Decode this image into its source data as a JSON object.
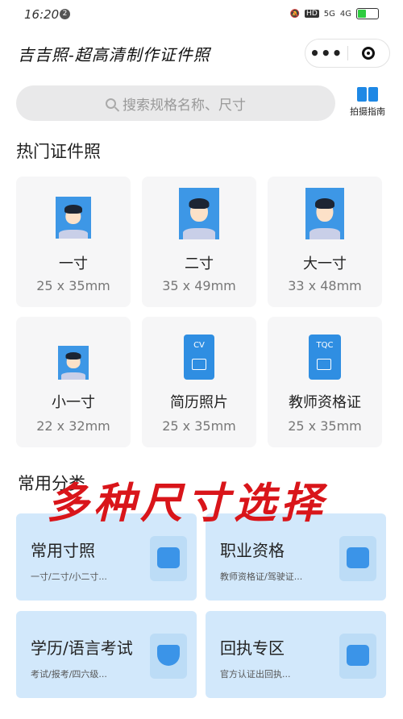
{
  "status": {
    "time": "16:20",
    "notif": "2",
    "hd": "HD",
    "net1": "5G",
    "net2": "4G",
    "battery": "10"
  },
  "titlebar": {
    "title": "吉吉照-超高清制作证件照",
    "more": "•••"
  },
  "search": {
    "placeholder": "搜索规格名称、尺寸"
  },
  "guide": {
    "label": "拍摄指南"
  },
  "hot": {
    "title": "热门证件照",
    "items": [
      {
        "name": "一寸",
        "size": "25 x 35mm",
        "icon": "photo-icon"
      },
      {
        "name": "二寸",
        "size": "35 x 49mm",
        "icon": "photo-icon"
      },
      {
        "name": "大一寸",
        "size": "33 x 48mm",
        "icon": "photo-icon"
      },
      {
        "name": "小一寸",
        "size": "22 x 32mm",
        "icon": "photo-icon"
      },
      {
        "name": "简历照片",
        "size": "25 x 35mm",
        "icon": "cv-document-icon",
        "code": "CV"
      },
      {
        "name": "教师资格证",
        "size": "25 x 35mm",
        "icon": "tqc-document-icon",
        "code": "TQC"
      }
    ]
  },
  "categories": {
    "title": "常用分类",
    "items": [
      {
        "name": "常用寸照",
        "sub": "一寸/二寸/小二寸...",
        "icon": "portrait-icon"
      },
      {
        "name": "职业资格",
        "sub": "教师资格证/驾驶证...",
        "icon": "id-card-icon"
      },
      {
        "name": "学历/语言考试",
        "sub": "考试/报考/四六级...",
        "icon": "graduation-cap-icon"
      },
      {
        "name": "回执专区",
        "sub": "官方认证出回执...",
        "icon": "receipt-icon"
      }
    ]
  },
  "overlay": {
    "text": "多种尺寸选择"
  },
  "colors": {
    "accent": "#3d97e6",
    "category_bg": "#d2e8fb",
    "overlay_red": "#d9151a"
  }
}
